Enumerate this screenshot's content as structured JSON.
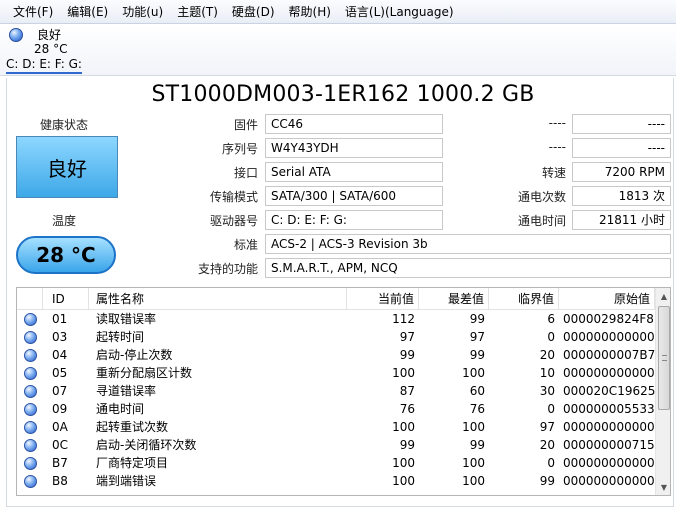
{
  "menu": [
    "文件(F)",
    "编辑(E)",
    "功能(u)",
    "主题(T)",
    "硬盘(D)",
    "帮助(H)",
    "语言(L)(Language)"
  ],
  "drive_tab": {
    "health": "良好",
    "temp": "28 °C",
    "letters": "C: D: E: F: G:"
  },
  "model": "ST1000DM003-1ER162 1000.2 GB",
  "health": {
    "label": "健康状态",
    "value": "良好"
  },
  "temperature": {
    "label": "温度",
    "value": "28 °C"
  },
  "info": {
    "firmware_label": "固件",
    "firmware": "CC46",
    "serial_label": "序列号",
    "serial": "W4Y43YDH",
    "interface_label": "接口",
    "interface": "Serial ATA",
    "transfer_label": "传输模式",
    "transfer": "SATA/300 | SATA/600",
    "drive_label": "驱动器号",
    "drive": "C: D: E: F: G:",
    "standard_label": "标准",
    "standard": "ACS-2 | ACS-3 Revision 3b",
    "features_label": "支持的功能",
    "features": "S.M.A.R.T., APM, NCQ",
    "blank1_label": "----",
    "blank1": "----",
    "blank2_label": "----",
    "blank2": "----",
    "rotation_label": "转速",
    "rotation": "7200 RPM",
    "power_count_label": "通电次数",
    "power_count": "1813 次",
    "power_hours_label": "通电时间",
    "power_hours": "21811 小时"
  },
  "smart": {
    "headers": [
      "ID",
      "属性名称",
      "当前值",
      "最差值",
      "临界值",
      "原始值"
    ],
    "rows": [
      {
        "id": "01",
        "name": "读取错误率",
        "current": "112",
        "worst": "99",
        "threshold": "6",
        "raw": "0000029824F8"
      },
      {
        "id": "03",
        "name": "起转时间",
        "current": "97",
        "worst": "97",
        "threshold": "0",
        "raw": "000000000000"
      },
      {
        "id": "04",
        "name": "启动-停止次数",
        "current": "99",
        "worst": "99",
        "threshold": "20",
        "raw": "0000000007B7"
      },
      {
        "id": "05",
        "name": "重新分配扇区计数",
        "current": "100",
        "worst": "100",
        "threshold": "10",
        "raw": "000000000000"
      },
      {
        "id": "07",
        "name": "寻道错误率",
        "current": "87",
        "worst": "60",
        "threshold": "30",
        "raw": "000020C19625"
      },
      {
        "id": "09",
        "name": "通电时间",
        "current": "76",
        "worst": "76",
        "threshold": "0",
        "raw": "000000005533"
      },
      {
        "id": "0A",
        "name": "起转重试次数",
        "current": "100",
        "worst": "100",
        "threshold": "97",
        "raw": "000000000000"
      },
      {
        "id": "0C",
        "name": "启动-关闭循环次数",
        "current": "99",
        "worst": "99",
        "threshold": "20",
        "raw": "000000000715"
      },
      {
        "id": "B7",
        "name": "厂商特定项目",
        "current": "100",
        "worst": "100",
        "threshold": "0",
        "raw": "000000000000"
      },
      {
        "id": "B8",
        "name": "端到端错误",
        "current": "100",
        "worst": "100",
        "threshold": "99",
        "raw": "000000000000"
      }
    ]
  }
}
